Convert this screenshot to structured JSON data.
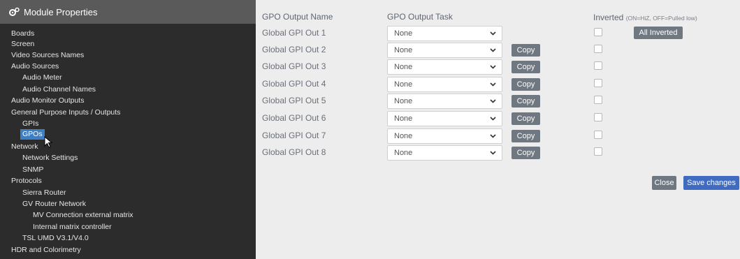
{
  "sidebar": {
    "title": "Module Properties",
    "icon": "gears-icon",
    "items": [
      {
        "label": "Boards",
        "level": 0
      },
      {
        "label": "Screen",
        "level": 0
      },
      {
        "label": "Video Sources Names",
        "level": 0
      },
      {
        "label": "Audio Sources",
        "level": 0
      },
      {
        "label": "Audio Meter",
        "level": 1
      },
      {
        "label": "Audio Channel Names",
        "level": 1
      },
      {
        "label": "Audio Monitor Outputs",
        "level": 0
      },
      {
        "label": "General Purpose Inputs / Outputs",
        "level": 0
      },
      {
        "label": "GPIs",
        "level": 1
      },
      {
        "label": "GPOs",
        "level": 1,
        "active": true
      },
      {
        "label": "Network",
        "level": 0
      },
      {
        "label": "Network Settings",
        "level": 1
      },
      {
        "label": "SNMP",
        "level": 1
      },
      {
        "label": "Protocols",
        "level": 0
      },
      {
        "label": "Sierra Router",
        "level": 1
      },
      {
        "label": "GV Router Network",
        "level": 1
      },
      {
        "label": "MV Connection external matrix",
        "level": 2
      },
      {
        "label": "Internal matrix controller",
        "level": 2
      },
      {
        "label": "TSL UMD V3.1/V4.0",
        "level": 1
      },
      {
        "label": "HDR and Colorimetry",
        "level": 0
      }
    ]
  },
  "main": {
    "headers": {
      "name": "GPO Output Name",
      "task": "GPO Output Task",
      "inverted": "Inverted",
      "inverted_note": "(ON=HiZ, OFF=Pulled low)"
    },
    "rows": [
      {
        "name": "Global GPI Out 1",
        "task": "None",
        "copy": ""
      },
      {
        "name": "Global GPI Out 2",
        "task": "None",
        "copy": "Copy"
      },
      {
        "name": "Global GPI Out 3",
        "task": "None",
        "copy": "Copy"
      },
      {
        "name": "Global GPI Out 4",
        "task": "None",
        "copy": "Copy"
      },
      {
        "name": "Global GPI Out 5",
        "task": "None",
        "copy": "Copy"
      },
      {
        "name": "Global GPI Out 6",
        "task": "None",
        "copy": "Copy"
      },
      {
        "name": "Global GPI Out 7",
        "task": "None",
        "copy": "Copy"
      },
      {
        "name": "Global GPI Out 8",
        "task": "None",
        "copy": "Copy"
      }
    ],
    "all_inverted_label": "All Inverted",
    "close_label": "Close",
    "save_label": "Save changes"
  },
  "colors": {
    "sidebar_bg": "#2c2c2c",
    "sidebar_header_bg": "#5a5a5a",
    "active_item": "#3d7fc7",
    "grey_button": "#6f7780",
    "primary_button": "#3f6bc0",
    "content_bg": "#ededed"
  }
}
